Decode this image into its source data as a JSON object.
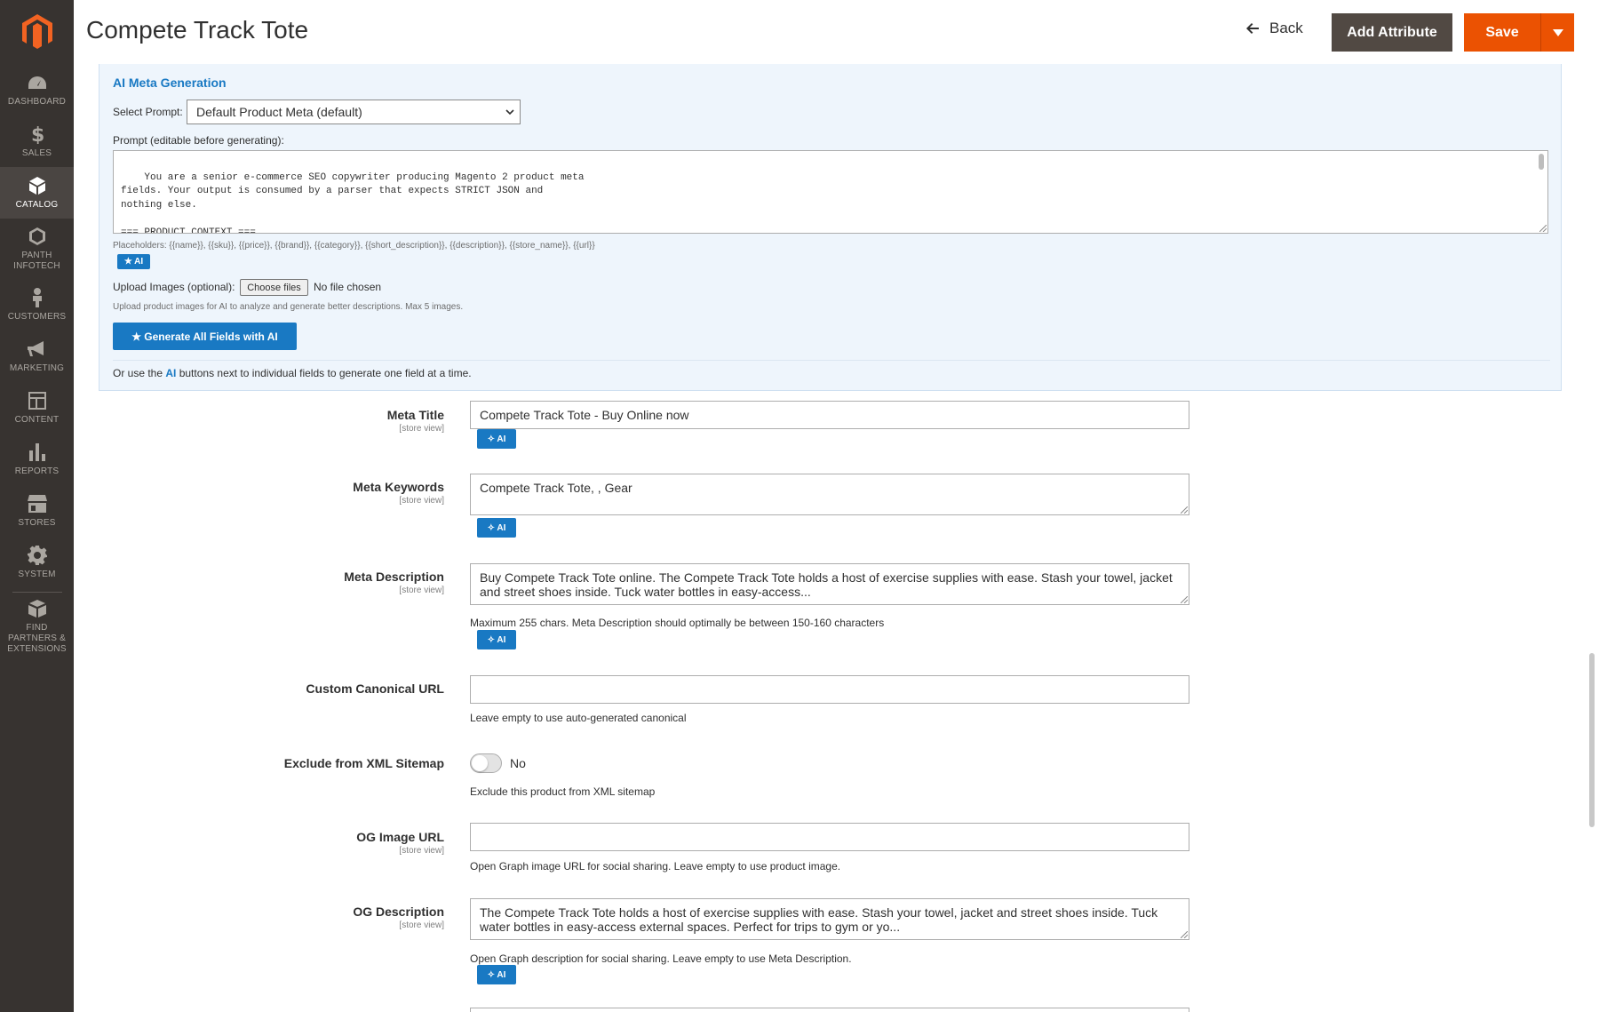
{
  "sidebar": {
    "items": [
      {
        "label": "DASHBOARD",
        "icon": "dashboard-icon"
      },
      {
        "label": "SALES",
        "icon": "dollar-icon"
      },
      {
        "label": "CATALOG",
        "icon": "cube-icon",
        "active": true
      },
      {
        "label": "PANTH INFOTECH",
        "icon": "hexagon-icon"
      },
      {
        "label": "CUSTOMERS",
        "icon": "person-icon"
      },
      {
        "label": "MARKETING",
        "icon": "megaphone-icon"
      },
      {
        "label": "CONTENT",
        "icon": "layout-icon"
      },
      {
        "label": "REPORTS",
        "icon": "bar-chart-icon"
      },
      {
        "label": "STORES",
        "icon": "store-icon"
      },
      {
        "label": "SYSTEM",
        "icon": "gear-icon"
      },
      {
        "label": "FIND PARTNERS & EXTENSIONS",
        "icon": "boxes-icon"
      }
    ]
  },
  "header": {
    "title": "Compete Track Tote",
    "back_label": "Back",
    "add_attribute_label": "Add Attribute",
    "save_label": "Save"
  },
  "ai_panel": {
    "title": "AI Meta Generation",
    "select_prompt_label": "Select Prompt:",
    "select_prompt_value": "Default Product Meta (default)",
    "prompt_label": "Prompt (editable before generating):",
    "prompt_text": "You are a senior e-commerce SEO copywriter producing Magento 2 product meta\nfields. Your output is consumed by a parser that expects STRICT JSON and\nnothing else.\n\n=== PRODUCT CONTEXT ===\nName: {{name}}",
    "placeholders": "Placeholders: {{name}}, {{sku}}, {{price}}, {{brand}}, {{category}}, {{short_description}}, {{description}}, {{store_name}}, {{url}}",
    "ai_badge": "★ AI",
    "upload_label": "Upload Images (optional):",
    "choose_files_label": "Choose files",
    "no_file_text": "No file chosen",
    "upload_help": "Upload product images for AI to analyze and generate better descriptions. Max 5 images.",
    "generate_all_label": "★ Generate All Fields with AI",
    "or_use_prefix": "Or use the ",
    "or_use_ai": "AI",
    "or_use_suffix": " buttons next to individual fields to generate one field at a time."
  },
  "fields": {
    "ai_button_label": "✧ AI",
    "meta_title": {
      "label": "Meta Title",
      "scope": "[store view]",
      "value": "Compete Track Tote - Buy Online now"
    },
    "meta_keywords": {
      "label": "Meta Keywords",
      "scope": "[store view]",
      "value": "Compete Track Tote, , Gear"
    },
    "meta_description": {
      "label": "Meta Description",
      "scope": "[store view]",
      "value": "Buy Compete Track Tote online. The Compete Track Tote holds a host of exercise supplies with ease. Stash your towel, jacket and street shoes inside. Tuck water bottles in easy-access...",
      "help": "Maximum 255 chars. Meta Description should optimally be between 150-160 characters"
    },
    "canonical_url": {
      "label": "Custom Canonical URL",
      "value": "",
      "help": "Leave empty to use auto-generated canonical"
    },
    "exclude_sitemap": {
      "label": "Exclude from XML Sitemap",
      "state": "No",
      "help": "Exclude this product from XML sitemap"
    },
    "og_image_url": {
      "label": "OG Image URL",
      "scope": "[store view]",
      "value": "",
      "help": "Open Graph image URL for social sharing. Leave empty to use product image."
    },
    "og_description": {
      "label": "OG Description",
      "scope": "[store view]",
      "value": "The Compete Track Tote holds a host of exercise supplies with ease. Stash your towel, jacket and street shoes inside. Tuck water bottles in easy-access external spaces. Perfect for trips to gym or yo...",
      "help": "Open Graph description for social sharing. Leave empty to use Meta Description."
    }
  },
  "colors": {
    "sidebar_bg": "#373330",
    "accent_blue": "#1979c3",
    "save_orange": "#eb5202",
    "panel_bg": "#eef5fc"
  }
}
